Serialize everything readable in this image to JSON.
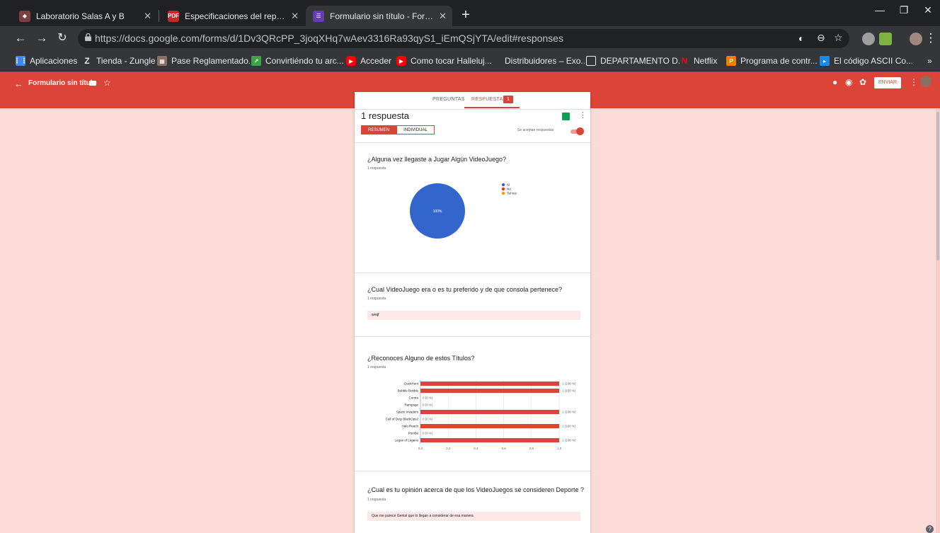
{
  "browser": {
    "tabs": [
      {
        "title": "Laboratorio Salas A y B",
        "favicon": "lab-favicon"
      },
      {
        "title": "Especificaciones del reporte de la",
        "favicon": "pdf-favicon"
      },
      {
        "title": "Formulario sin título - Formulario",
        "favicon": "forms-favicon"
      }
    ],
    "url": "https://docs.google.com/forms/d/1Dv3QRcPP_3joqXHq7wAev3316Ra93qyS1_iEmQSjYTA/edit#responses",
    "bookmarks": [
      {
        "label": "Aplicaciones",
        "icon": "apps-grid-icon"
      },
      {
        "label": "Tienda - Zungle",
        "icon": "zungle-icon"
      },
      {
        "label": "Pase Reglamentado...",
        "icon": "uaq-icon"
      },
      {
        "label": "Convirtiéndo tu arc...",
        "icon": "converter-icon"
      },
      {
        "label": "Acceder",
        "icon": "youtube-icon"
      },
      {
        "label": "Como tocar Halleluj...",
        "icon": "youtube-icon"
      },
      {
        "label": "Distribuidores – Exo...",
        "icon": "none"
      },
      {
        "label": "DEPARTAMENTO D...",
        "icon": "doc-icon"
      },
      {
        "label": "Netflix",
        "icon": "netflix-icon"
      },
      {
        "label": "Programa de contr...",
        "icon": "program-icon"
      },
      {
        "label": "El código ASCII Co...",
        "icon": "ascii-icon"
      }
    ],
    "more_bookmarks": "»"
  },
  "form_header": {
    "back": "←",
    "title": "Formulario sin título",
    "send_label": "ENVIAR"
  },
  "card": {
    "tabs": {
      "questions": "PREGUNTAS",
      "responses": "RESPUESTAS",
      "responses_count": "1"
    },
    "count_label": "1 respuesta",
    "summary": "RESUMEN",
    "individual": "INDIVIDUAL",
    "accepting": "Se aceptan respuestas"
  },
  "questions": [
    {
      "title": "¿Alguna vez llegaste a Jugar Algún VideoJuego?",
      "subtitle": "1 respuesta",
      "type": "pie"
    },
    {
      "title": "¿Cual VideoJuego era o es tu preferido y de que consola pertenece?",
      "subtitle": "1 respuesta",
      "answer": "weqf"
    },
    {
      "title": "¿Reconoces Alguno de estos Títulos?",
      "subtitle": "1 respuesta",
      "type": "bar"
    },
    {
      "title": "¿Cual es tu opinión acerca de que los VideoJuegos se consideren Deporte ?",
      "subtitle": "1 respuesta",
      "answer": "Que me parece Genial que lo llegan a considerar de esa manera"
    }
  ],
  "chart_data": [
    {
      "type": "pie",
      "categories": [
        "Sí",
        "No",
        "Tal vez"
      ],
      "values": [
        100,
        0,
        0
      ],
      "colors": [
        "#3366cc",
        "#dc3912",
        "#ff9900"
      ],
      "slice_label": "100%",
      "legend": "right"
    },
    {
      "type": "bar",
      "orientation": "horizontal",
      "categories": [
        "DuckHunt",
        "Bubble Bobble",
        "Contra",
        "Rampage",
        "Space Invaders",
        "Call of Duty BlackOps2",
        "Halo Reach",
        "Pombe",
        "Legue of Legens"
      ],
      "values": [
        1,
        1,
        0,
        0,
        1,
        0,
        1,
        0,
        1
      ],
      "value_labels": [
        "1 (100 %)",
        "1 (100 %)",
        "0 (0 %)",
        "0 (0 %)",
        "1 (100 %)",
        "0 (0 %)",
        "1 (100 %)",
        "0 (0 %)",
        "1 (100 %)"
      ],
      "xlim": [
        0,
        1
      ],
      "xticks": [
        "0,0",
        "0,2",
        "0,4",
        "0,6",
        "0,8",
        "1,0"
      ],
      "grid": true,
      "color": "#db4437"
    }
  ]
}
